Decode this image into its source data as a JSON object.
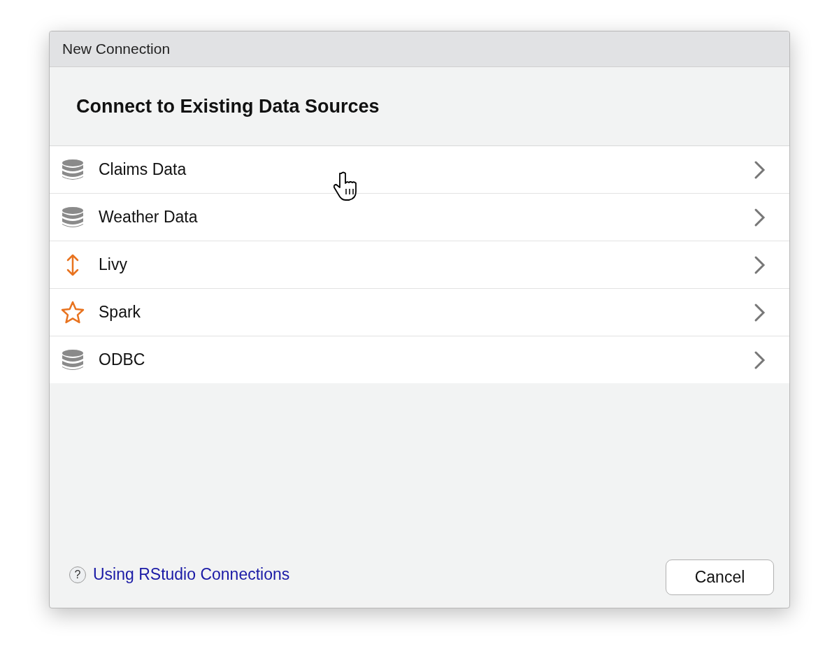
{
  "window": {
    "title": "New Connection"
  },
  "heading": "Connect to Existing Data Sources",
  "sources": [
    {
      "label": "Claims Data",
      "kind": "database"
    },
    {
      "label": "Weather Data",
      "kind": "database"
    },
    {
      "label": "Livy",
      "kind": "arrows"
    },
    {
      "label": "Spark",
      "kind": "star"
    },
    {
      "label": "ODBC",
      "kind": "database"
    }
  ],
  "help_link": {
    "icon": "?",
    "label": "Using RStudio Connections"
  },
  "buttons": [
    "Cancel"
  ]
}
